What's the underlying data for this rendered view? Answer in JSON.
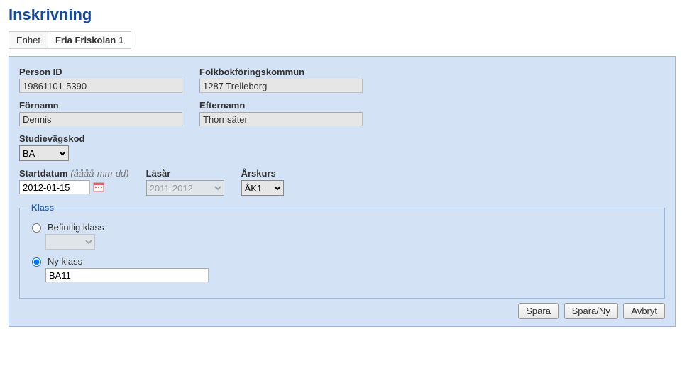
{
  "page": {
    "title": "Inskrivning"
  },
  "enhetBar": {
    "label": "Enhet",
    "value": "Fria Friskolan 1"
  },
  "fields": {
    "personId": {
      "label": "Person ID",
      "value": "19861101-5390"
    },
    "kommun": {
      "label": "Folkbokföringskommun",
      "value": "1287 Trelleborg"
    },
    "fornamn": {
      "label": "Förnamn",
      "value": "Dennis"
    },
    "efternamn": {
      "label": "Efternamn",
      "value": "Thornsäter"
    },
    "studievag": {
      "label": "Studievägskod",
      "value": "BA"
    },
    "startdatum": {
      "label": "Startdatum",
      "hint": "(åååå-mm-dd)",
      "value": "2012-01-15"
    },
    "lasar": {
      "label": "Läsår",
      "value": "2011-2012"
    },
    "arskurs": {
      "label": "Årskurs",
      "value": "ÅK1"
    }
  },
  "klass": {
    "legend": "Klass",
    "befintlig": {
      "label": "Befintlig klass",
      "value": "",
      "selected": false
    },
    "ny": {
      "label": "Ny klass",
      "value": "BA11",
      "selected": true
    }
  },
  "buttons": {
    "spara": "Spara",
    "sparaNy": "Spara/Ny",
    "avbryt": "Avbryt"
  }
}
